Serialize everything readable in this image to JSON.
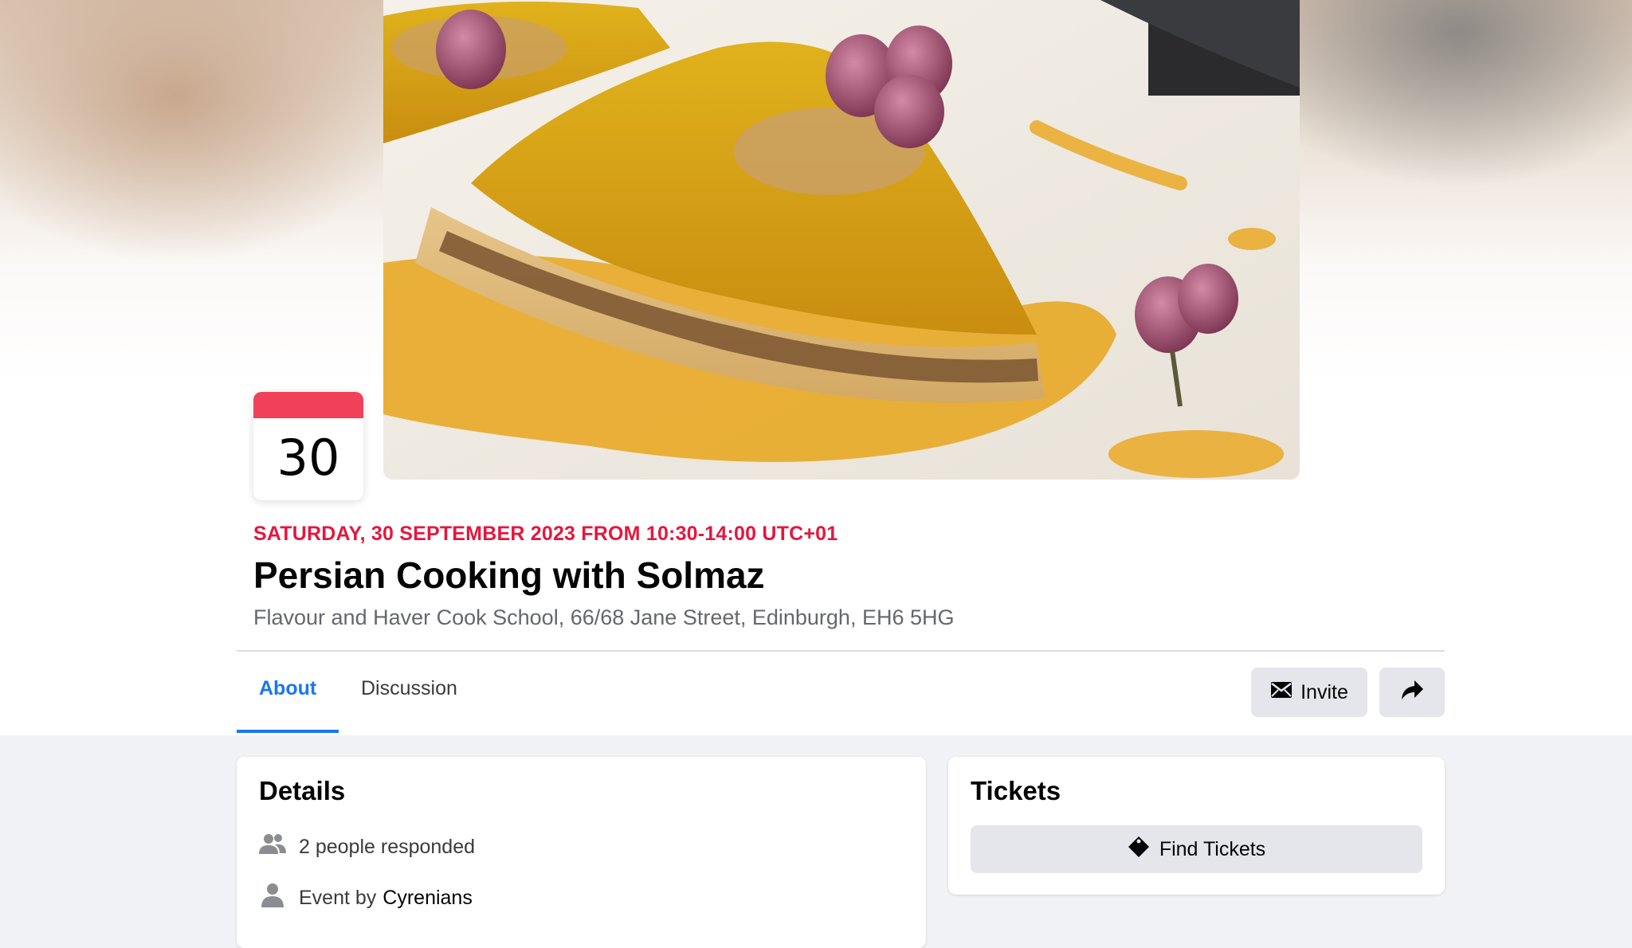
{
  "event": {
    "day_number": "30",
    "date_line": "SATURDAY, 30 SEPTEMBER 2023 FROM 10:30-14:00 UTC+01",
    "title": "Persian Cooking with Solmaz",
    "location": "Flavour and Haver Cook School, 66/68 Jane Street, Edinburgh, EH6 5HG"
  },
  "tabs": [
    {
      "label": "About",
      "active": true
    },
    {
      "label": "Discussion",
      "active": false
    }
  ],
  "actions": {
    "invite_label": "Invite",
    "invite_icon": "envelope-icon",
    "share_icon": "share-arrow-icon"
  },
  "details": {
    "heading": "Details",
    "responded_text": "2 people responded",
    "responded_icon": "people-icon",
    "event_by_prefix": "Event by",
    "host_name": "Cyrenians",
    "host_icon": "person-icon"
  },
  "tickets": {
    "heading": "Tickets",
    "find_label": "Find Tickets",
    "find_icon": "ticket-icon"
  },
  "colors": {
    "accent": "#1877f2",
    "date_red": "#e4173e",
    "calendar_strip": "#f0405a"
  }
}
